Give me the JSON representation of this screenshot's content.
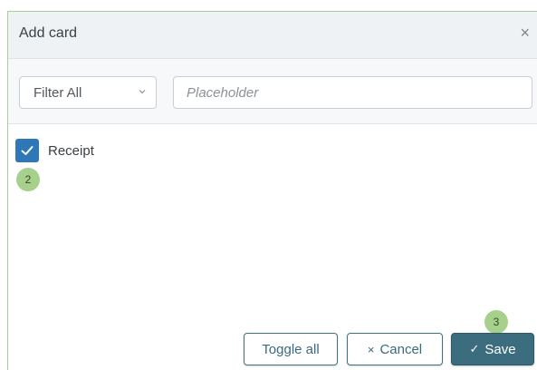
{
  "dialog": {
    "title": "Add card",
    "close_glyph": "×"
  },
  "filter": {
    "select_value": "Filter All",
    "search_placeholder": "Placeholder"
  },
  "items": [
    {
      "label": "Receipt",
      "checked": true
    }
  ],
  "badges": {
    "step2": "2",
    "step3": "3"
  },
  "buttons": {
    "toggle_all": "Toggle all",
    "cancel": "Cancel",
    "cancel_icon": "×",
    "save": "Save",
    "save_icon": "✓"
  },
  "colors": {
    "accent": "#2e78b7",
    "primary_button": "#3c6d7f",
    "badge": "#a8d08d"
  }
}
